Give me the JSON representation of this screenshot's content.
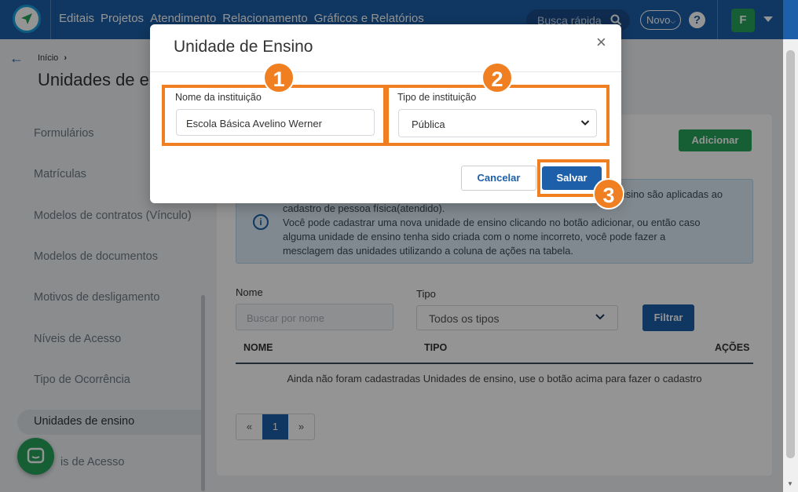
{
  "nav": {
    "menu": [
      "Editais",
      "Projetos",
      "Atendimento",
      "Relacionamento",
      "Gráficos e Relatórios"
    ],
    "search_label": "Busca rápida",
    "novo_label": "Novo",
    "help_label": "?",
    "avatar_letter": "F"
  },
  "header": {
    "breadcrumb": "Início",
    "breadcrumb_sep": "›",
    "title": "Unidades de e"
  },
  "sidebar": {
    "items": [
      {
        "label": "Formulários"
      },
      {
        "label": "Matrículas"
      },
      {
        "label": "Modelos de contratos (Vínculo)"
      },
      {
        "label": "Modelos de documentos"
      },
      {
        "label": "Motivos de desligamento"
      },
      {
        "label": "Níveis de Acesso"
      },
      {
        "label": "Tipo de Ocorrência"
      },
      {
        "label": "Unidades de ensino"
      },
      {
        "label": "is de Acesso"
      }
    ]
  },
  "main": {
    "add_label": "Adicionar",
    "info_lines": [
      "nsino são aplicadas ao",
      "cadastro de pessoa física(atendido).",
      "Você pode cadastrar uma nova unidade de ensino clicando no botão adicionar, ou então caso",
      "alguma unidade de ensino tenha sido criada com o nome incorreto, você pode fazer a",
      "mesclagem das unidades utilizando a coluna de ações na tabela."
    ],
    "filters": {
      "name_label": "Nome",
      "name_placeholder": "Buscar por nome",
      "type_label": "Tipo",
      "type_value": "Todos os tipos",
      "filter_button": "Filtrar"
    },
    "table": {
      "headers": [
        "NOME",
        "TIPO",
        "AÇÕES"
      ],
      "empty_message": "Ainda não foram cadastradas Unidades de ensino, use o botão acima para fazer o cadastro"
    },
    "pagination": {
      "prev": "«",
      "current": "1",
      "next": "»"
    }
  },
  "modal": {
    "title": "Unidade de Ensino",
    "close": "×",
    "name_label": "Nome da instituição",
    "name_value": "Escola Básica Avelino Werner",
    "type_label": "Tipo de instituição",
    "type_value": "Pública",
    "cancel_label": "Cancelar",
    "save_label": "Salvar"
  },
  "annotations": {
    "markers": [
      "1",
      "2",
      "3"
    ],
    "color": "#f07f22"
  },
  "colors": {
    "primary": "#1d5fa8",
    "success": "#27a35a",
    "accent": "#f07f22"
  }
}
